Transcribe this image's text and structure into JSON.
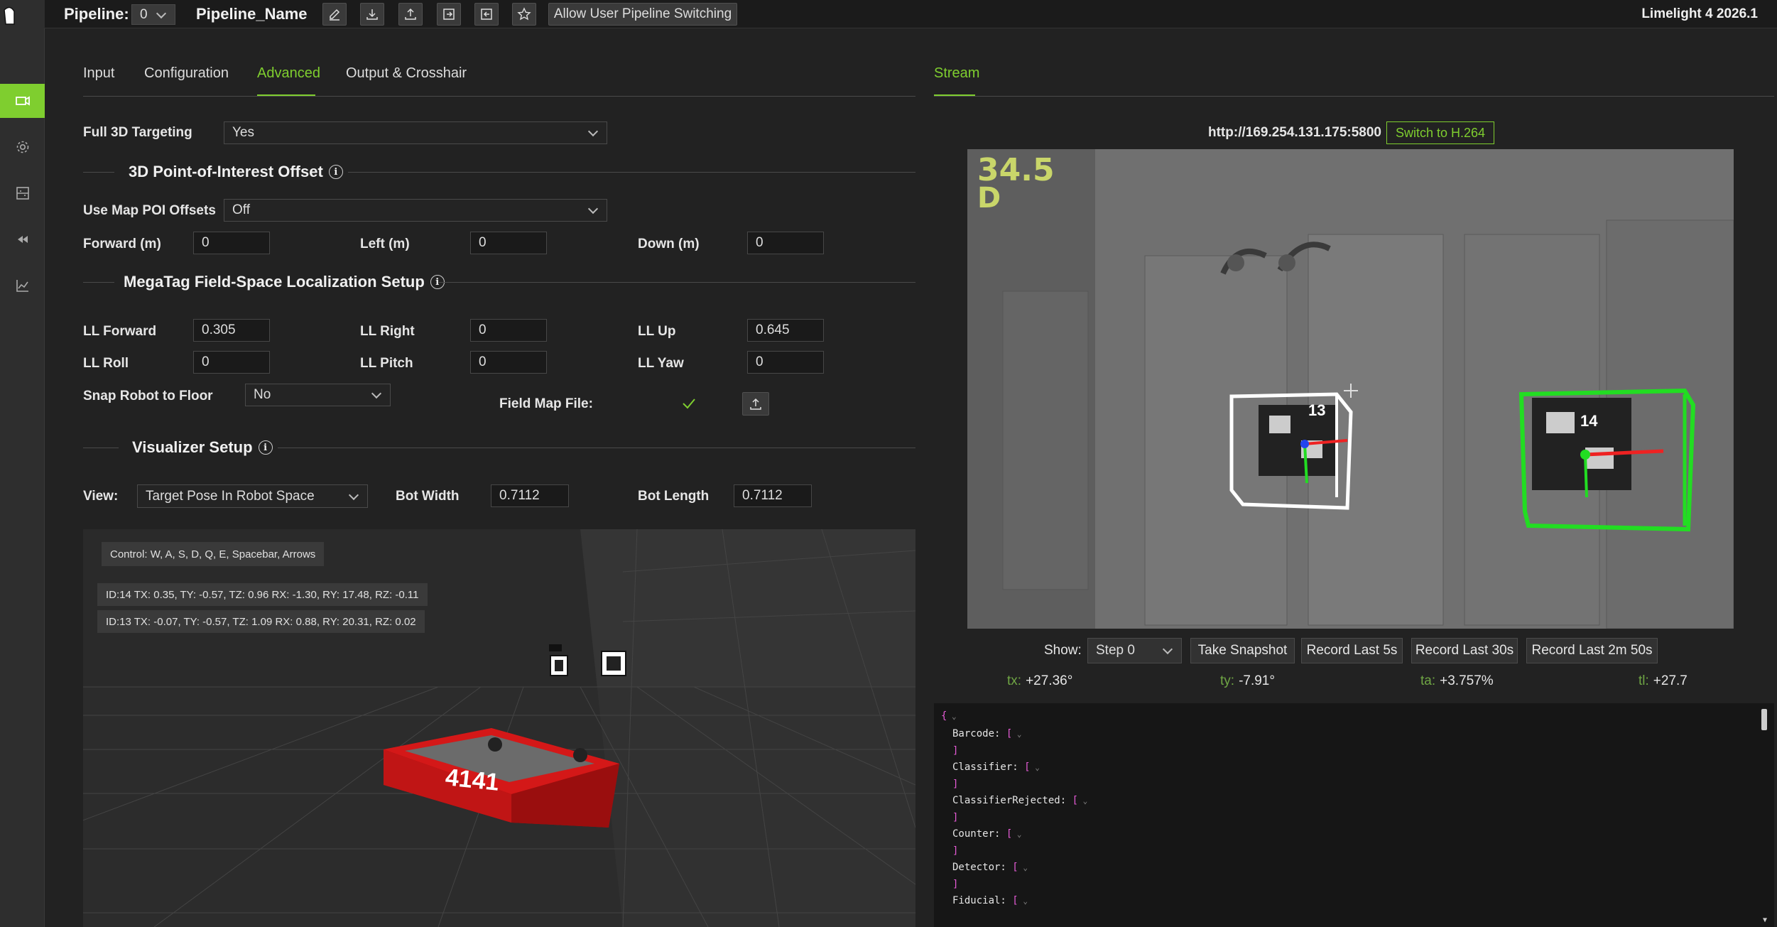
{
  "topbar": {
    "pipeline_label": "Pipeline:",
    "pipeline_index": "0",
    "pipeline_name": "Pipeline_Name",
    "switching_button": "Allow User Pipeline Switching",
    "product": "Limelight 4 2026.1"
  },
  "sidebar": {
    "items": [
      {
        "icon": "camera-icon",
        "active": true
      },
      {
        "icon": "gear-icon",
        "active": false
      },
      {
        "icon": "field-map-icon",
        "active": false
      },
      {
        "icon": "rewind-icon",
        "active": false
      },
      {
        "icon": "chart-icon",
        "active": false
      }
    ]
  },
  "tabs": {
    "input": "Input",
    "configuration": "Configuration",
    "advanced": "Advanced",
    "output": "Output & Crosshair",
    "active": "Advanced"
  },
  "advanced": {
    "full3d_label": "Full 3D Targeting",
    "full3d_value": "Yes",
    "poi_section": "3D Point-of-Interest Offset",
    "map_poi_label": "Use Map POI Offsets",
    "map_poi_value": "Off",
    "forward_label": "Forward (m)",
    "forward_value": "0",
    "left_label": "Left (m)",
    "left_value": "0",
    "down_label": "Down (m)",
    "down_value": "0",
    "megatag_section": "MegaTag Field-Space Localization Setup",
    "ll_forward_label": "LL Forward",
    "ll_forward_value": "0.305",
    "ll_right_label": "LL Right",
    "ll_right_value": "0",
    "ll_up_label": "LL Up",
    "ll_up_value": "0.645",
    "ll_roll_label": "LL Roll",
    "ll_roll_value": "0",
    "ll_pitch_label": "LL Pitch",
    "ll_pitch_value": "0",
    "ll_yaw_label": "LL Yaw",
    "ll_yaw_value": "0",
    "snap_label": "Snap Robot to Floor",
    "snap_value": "No",
    "field_map_label": "Field Map File:",
    "visualizer_section": "Visualizer Setup",
    "view_label": "View:",
    "view_value": "Target Pose In Robot Space",
    "bot_width_label": "Bot Width",
    "bot_width_value": "0.7112",
    "bot_length_label": "Bot Length",
    "bot_length_value": "0.7112"
  },
  "visualizer": {
    "controls": "Control: W, A, S, D, Q, E, Spacebar, Arrows",
    "tag14": "ID:14 TX: 0.35, TY: -0.57, TZ: 0.96 RX: -1.30, RY: 17.48, RZ: -0.11",
    "tag13": "ID:13 TX: -0.07, TY: -0.57, TZ: 1.09 RX: 0.88, RY: 20.31, RZ: 0.02",
    "robot_number": "4141",
    "robot_color": "#c81414"
  },
  "stream": {
    "tab": "Stream",
    "url": "http://169.254.131.175:5800",
    "switch_button": "Switch to H.264",
    "overlay_fps": "34.5",
    "overlay_mode": "D",
    "tag_left": "13",
    "tag_right": "14",
    "show_label": "Show:",
    "show_value": "Step 0",
    "snapshot": "Take Snapshot",
    "rec5": "Record Last 5s",
    "rec30": "Record Last 30s",
    "rec250": "Record Last 2m 50s",
    "tx_key": "tx:",
    "tx": "+27.36°",
    "ty_key": "ty:",
    "ty": "-7.91°",
    "ta_key": "ta:",
    "ta": "+3.757%",
    "tl_key": "tl:",
    "tl": "+27.7"
  },
  "json_view": {
    "open": "{",
    "lines": [
      {
        "key": "Barcode:",
        "open": "["
      },
      {
        "key": "",
        "open": "]"
      },
      {
        "key": "Classifier:",
        "open": "["
      },
      {
        "key": "",
        "open": "]"
      },
      {
        "key": "ClassifierRejected:",
        "open": "["
      },
      {
        "key": "",
        "open": "]"
      },
      {
        "key": "Counter:",
        "open": "["
      },
      {
        "key": "",
        "open": "]"
      },
      {
        "key": "Detector:",
        "open": "["
      },
      {
        "key": "",
        "open": "]"
      },
      {
        "key": "Fiducial:",
        "open": "["
      }
    ]
  },
  "colors": {
    "accent": "#7fce2f",
    "target_green": "#22dd22",
    "target_white": "#ffffff"
  }
}
